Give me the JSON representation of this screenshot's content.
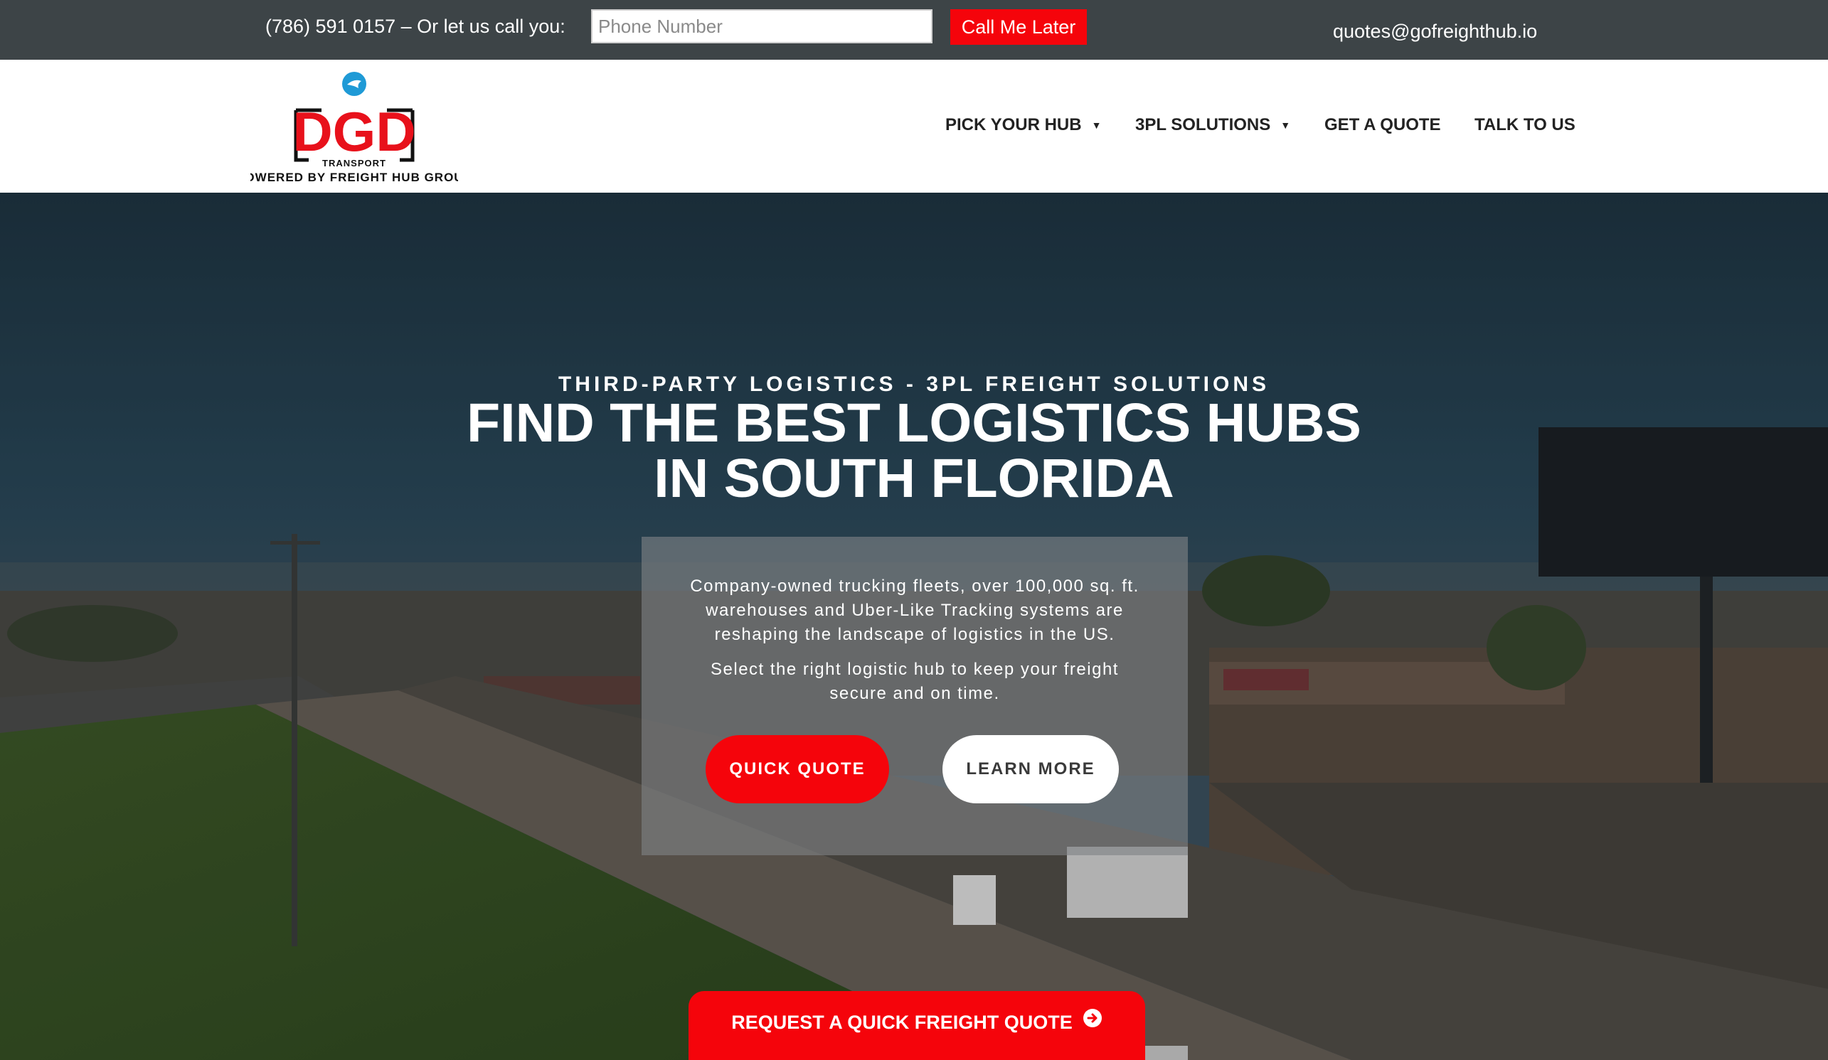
{
  "topbar": {
    "phone_text": "(786) 591 0157  –  Or let us call you:",
    "phone_placeholder": "Phone Number",
    "call_button": "Call Me Later",
    "email": "quotes@gofreighthub.io"
  },
  "logo": {
    "wordmark": "DGD",
    "sub": "TRANSPORT",
    "tagline": "POWERED BY FREIGHT HUB GROUP"
  },
  "nav": {
    "items": [
      {
        "label": "PICK YOUR HUB",
        "icon": "caret-down-icon"
      },
      {
        "label": "3PL SOLUTIONS",
        "icon": "caret-down-icon"
      },
      {
        "label": "GET A QUOTE"
      },
      {
        "label": "TALK TO US"
      }
    ]
  },
  "hero": {
    "eyebrow": "THIRD-PARTY LOGISTICS - 3PL FREIGHT SOLUTIONS",
    "headline_line1": "FIND THE BEST LOGISTICS HUBS",
    "headline_line2": "IN SOUTH FLORIDA",
    "paragraph1_lines": [
      "Company-owned trucking fleets, over 100,000 sq. ft.",
      "warehouses and Uber-Like Tracking systems are",
      "reshaping the landscape of logistics in the US."
    ],
    "paragraph2_lines": [
      "Select the right logistic hub to keep your freight",
      "secure and on time."
    ],
    "quick_quote": "QUICK QUOTE",
    "learn_more": "LEARN MORE",
    "request_quote": "REQUEST A QUICK FREIGHT QUOTE",
    "request_icon": "arrow-circle-right-icon"
  },
  "colors": {
    "accent_red": "#f5040b",
    "topbar": "#3d4447",
    "logo_blue": "#1f9ad6"
  }
}
